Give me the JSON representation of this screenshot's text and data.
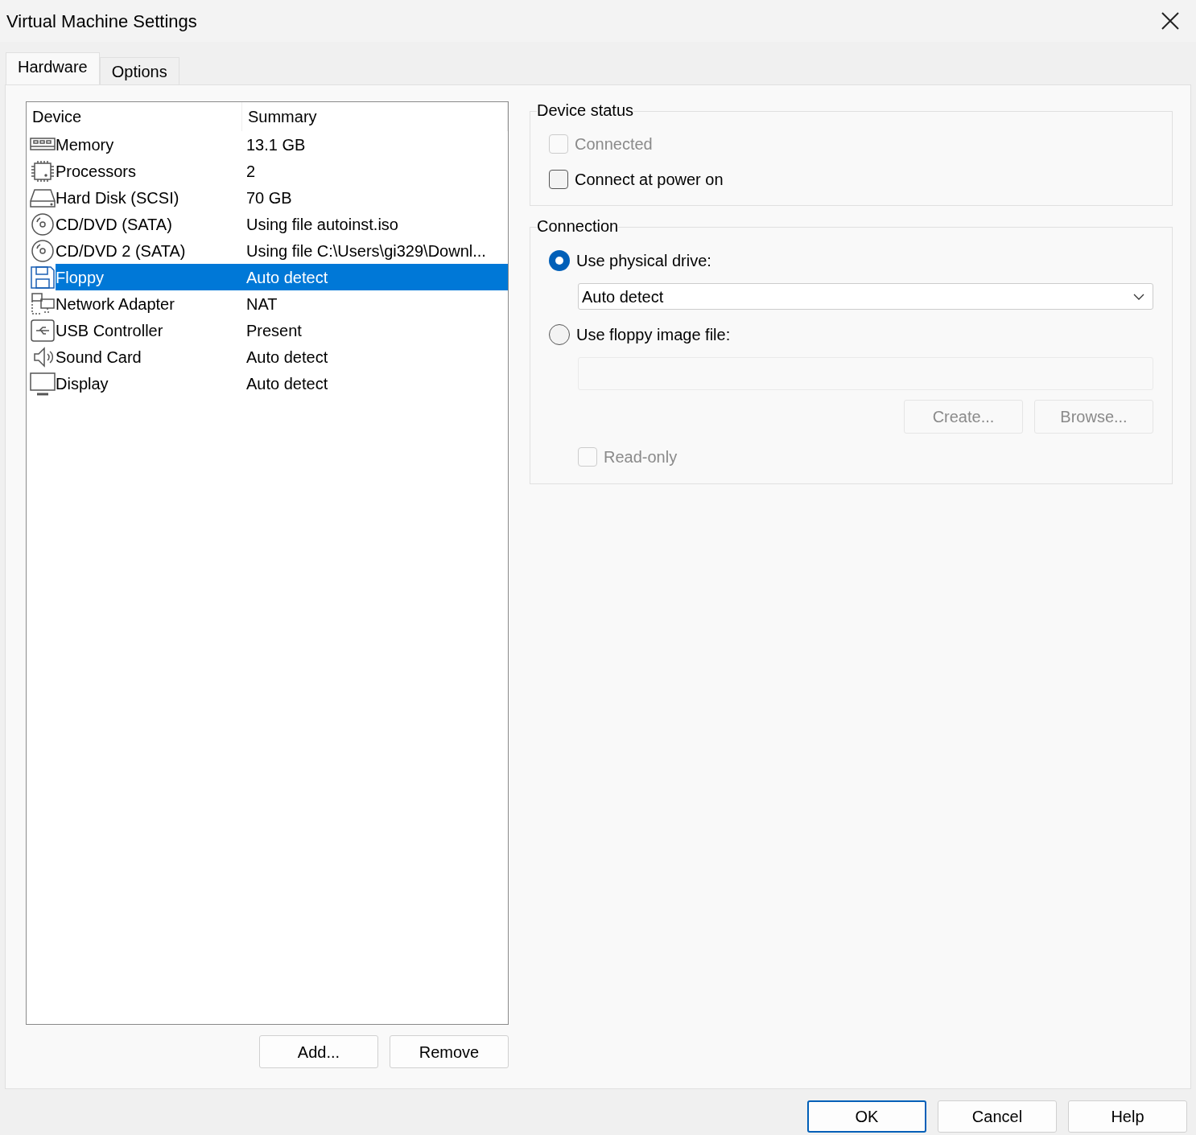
{
  "window": {
    "title": "Virtual Machine Settings"
  },
  "tabs": [
    {
      "label": "Hardware",
      "selected": true
    },
    {
      "label": "Options",
      "selected": false
    }
  ],
  "device_list": {
    "columns": [
      "Device",
      "Summary"
    ],
    "rows": [
      {
        "kind": "memory",
        "device": "Memory",
        "summary": "13.1 GB",
        "selected": false
      },
      {
        "kind": "processor",
        "device": "Processors",
        "summary": "2",
        "selected": false
      },
      {
        "kind": "disk",
        "device": "Hard Disk (SCSI)",
        "summary": "70 GB",
        "selected": false
      },
      {
        "kind": "cd",
        "device": "CD/DVD (SATA)",
        "summary": "Using file autoinst.iso",
        "selected": false
      },
      {
        "kind": "cd",
        "device": "CD/DVD 2 (SATA)",
        "summary": "Using file C:\\Users\\gi329\\Downl...",
        "selected": false
      },
      {
        "kind": "floppy",
        "device": "Floppy",
        "summary": "Auto detect",
        "selected": true
      },
      {
        "kind": "network",
        "device": "Network Adapter",
        "summary": "NAT",
        "selected": false
      },
      {
        "kind": "usb",
        "device": "USB Controller",
        "summary": "Present",
        "selected": false
      },
      {
        "kind": "sound",
        "device": "Sound Card",
        "summary": "Auto detect",
        "selected": false
      },
      {
        "kind": "display",
        "device": "Display",
        "summary": "Auto detect",
        "selected": false
      }
    ]
  },
  "list_buttons": [
    {
      "label": "Add..."
    },
    {
      "label": "Remove"
    }
  ],
  "device_status": {
    "title": "Device status",
    "options": [
      {
        "label": "Connected",
        "checked": false,
        "disabled": true
      },
      {
        "label": "Connect at power on",
        "checked": false,
        "disabled": false
      }
    ]
  },
  "connection": {
    "title": "Connection",
    "physical": {
      "label": "Use physical drive:",
      "selected": true,
      "value": "Auto detect"
    },
    "image": {
      "label": "Use floppy image file:",
      "selected": false,
      "disabled": true
    },
    "buttons": [
      {
        "label": "Create...",
        "disabled": true
      },
      {
        "label": "Browse...",
        "disabled": true
      }
    ],
    "read_only": {
      "label": "Read-only",
      "checked": false,
      "disabled": true
    }
  },
  "footer_buttons": [
    {
      "label": "OK",
      "default": true
    },
    {
      "label": "Cancel",
      "default": false
    },
    {
      "label": "Help",
      "default": false
    }
  ]
}
